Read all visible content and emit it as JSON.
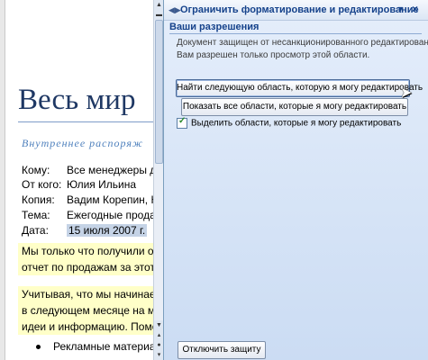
{
  "document": {
    "title": "Весь мир",
    "subtitle": "Внутреннее распоряж",
    "fields": [
      {
        "label": "Кому:",
        "value": "Все менеджеры до"
      },
      {
        "label": "От кого:",
        "value": "Юлия Ильина"
      },
      {
        "label": "Копия:",
        "value": "Вадим Корепин, Н"
      },
      {
        "label": "Тема:",
        "value": "Ежегодные продаж"
      },
      {
        "label": "Дата:",
        "value": "15 июля 2007 г."
      }
    ],
    "paragraph1": [
      "Мы только что получили око",
      "отчет по продажам за этот г"
    ],
    "paragraph2": [
      "Учитывая, что мы начинаем",
      "в следующем месяце на меж",
      "идеи и информацию. Помощ"
    ],
    "bullet": "Рекламные материа"
  },
  "pane": {
    "title": "Ограничить форматирование и редактирование",
    "section": "Ваши разрешения",
    "info_line1": "Документ защищен от несанкционированного редактирования.",
    "info_line2": "Вам разрешен только просмотр этой области.",
    "btn_next": "Найти следующую область, которую я могу редактировать",
    "btn_show": "Показать все области, которые я могу редактировать",
    "checkbox_label": "Выделить области, которые я могу редактировать",
    "checkbox_checked": true,
    "btn_stop": "Отключить защиту"
  },
  "icons": {
    "nav": "back-forward-icon",
    "dropdown": "dropdown-icon",
    "close": "close-icon",
    "cursor": "mouse-pointer-icon"
  }
}
